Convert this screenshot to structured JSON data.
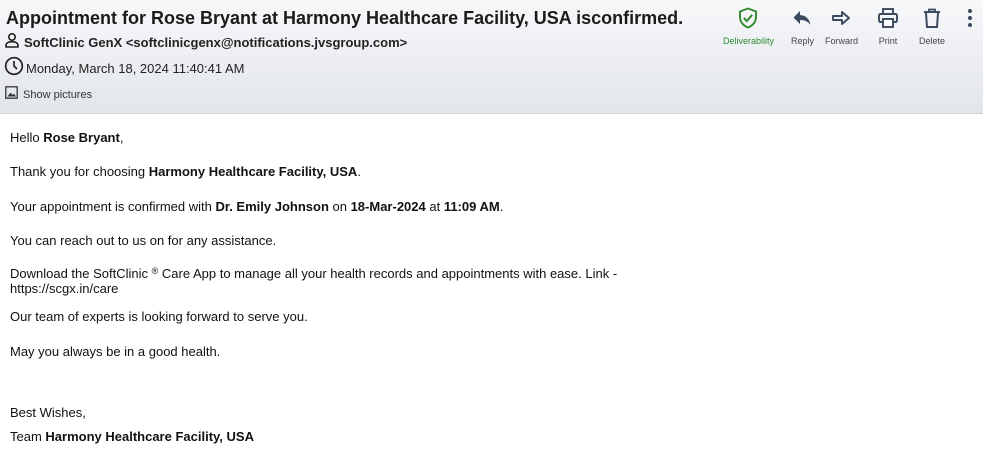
{
  "email": {
    "subject": "Appointment for Rose Bryant at Harmony Healthcare Facility, USA isconfirmed.",
    "sender": "SoftClinic GenX <softclinicgenx@notifications.jvsgroup.com>",
    "date": "Monday, March 18, 2024 11:40:41 AM",
    "show_pictures": "Show pictures"
  },
  "toolbar": {
    "deliverability": "Deliverability",
    "reply": "Reply",
    "forward": "Forward",
    "print": "Print",
    "delete": "Delete"
  },
  "colors": {
    "deliverability_green": "#2f8a2f",
    "header_top": "#f7f8fa",
    "header_bottom": "#e2e5ea"
  },
  "body": {
    "greeting_prefix": "Hello ",
    "patient_name": "Rose Bryant",
    "greeting_suffix": ",",
    "thanks_prefix": "Thank you for choosing ",
    "facility": "Harmony Healthcare Facility, USA",
    "thanks_suffix": ".",
    "appt_prefix": "Your appointment is confirmed with ",
    "doctor": "Dr. Emily Johnson",
    "appt_mid1": " on ",
    "appt_date": "18-Mar-2024",
    "appt_mid2": " at ",
    "appt_time": "11:09 AM",
    "appt_suffix": ".",
    "reach_out": "You can reach out to us on for any assistance.",
    "download_prefix": "Download the SoftClinic ",
    "registered": "®",
    "download_suffix": " Care App to manage all your health records and appointments with ease. Link -",
    "link": "https://scgx.in/care",
    "experts": "Our team of experts is looking forward to serve you.",
    "health": "May you always be in a good health.",
    "best_wishes": "Best Wishes,",
    "team_prefix": "Team ",
    "team_name": "Harmony Healthcare Facility, USA"
  }
}
